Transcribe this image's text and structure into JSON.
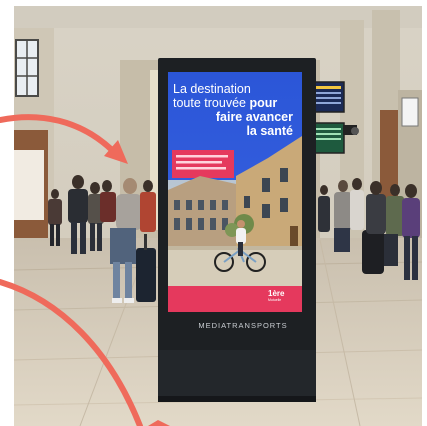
{
  "poster": {
    "headline_line1": "La destination",
    "headline_line2_a": "toute trouvée ",
    "headline_line2_b": "pour",
    "headline_line3": "faire avancer",
    "headline_line4": "la santé",
    "brand_logo_text": "1ère",
    "brand_logo_subtext": "Mutuelle"
  },
  "kiosk": {
    "label": "MEDIATRANSPORTS"
  },
  "colors": {
    "poster_blue": "#2b56d8",
    "poster_pink": "#e5395d",
    "arrow_coral": "#ef6a5b",
    "kiosk_body": "#1d2023"
  }
}
